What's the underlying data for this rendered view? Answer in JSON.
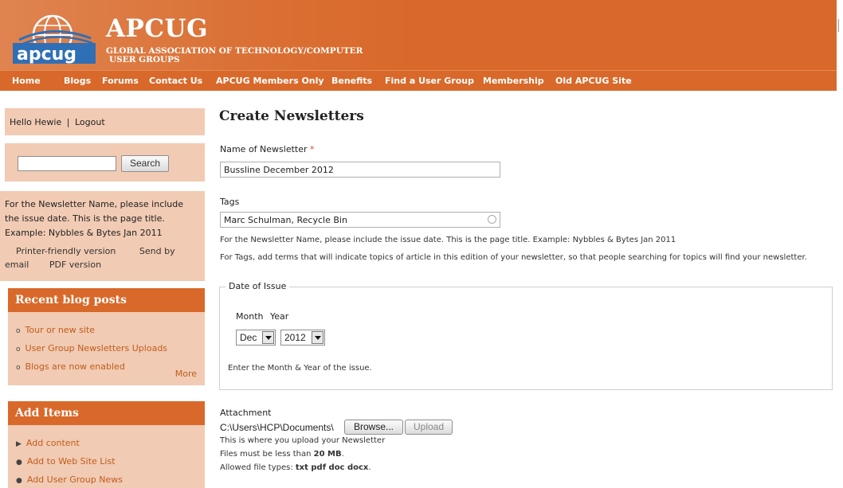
{
  "header": {
    "title": "APCUG",
    "subtitle_line1": "GLOBAL ASSOCIATION OF TECHNOLOGY/COMPUTER",
    "subtitle_line2": "USER GROUPS",
    "logo_text": "apcug"
  },
  "nav": [
    "Home",
    "Blogs",
    "Forums",
    "Contact Us",
    "APCUG Members Only",
    "Benefits",
    "Find a User Group",
    "Membership",
    "Old APCUG Site"
  ],
  "sidebar": {
    "hello": "Hello Hewie",
    "separator": "|",
    "logout": "Logout",
    "search_button": "Search",
    "search_value": "",
    "note_line1": "For the Newsletter Name, please include",
    "note_line2": "the issue date. This is the page title.",
    "note_line3": "Example: Nybbles & Bytes Jan 2011",
    "printer_friendly": "Printer-friendly version",
    "send_by": "Send by",
    "email": "email",
    "pdf_version": "PDF version",
    "recent_title": "Recent blog posts",
    "recent_items": [
      "Tour or new site",
      "User Group Newsletters Uploads",
      "Blogs are now enabled"
    ],
    "more": "More",
    "add_title": "Add Items",
    "add_items": [
      "Add content",
      "Add to Web Site List",
      "Add User Group News"
    ]
  },
  "main": {
    "title": "Create Newsletters",
    "name_label": "Name of Newsletter",
    "required_mark": "*",
    "name_value": "Bussline December 2012",
    "tags_label": "Tags",
    "tags_value": "Marc Schulman, Recycle Bin",
    "help1": "For the Newsletter Name, please include the issue date. This is the page title. Example: Nybbles & Bytes Jan 2011",
    "help2": "For Tags, add terms that will indicate topics of article in this edition of your newsletter, so that people searching for topics will find your newsletter.",
    "date_legend": "Date of Issue",
    "month_label": "Month",
    "year_label": "Year",
    "month_value": "Dec",
    "year_value": "2012",
    "date_help": "Enter the Month & Year of the issue.",
    "attachment_label": "Attachment",
    "file_path": "C:\\Users\\HCP\\Documents\\",
    "browse": "Browse...",
    "upload": "Upload",
    "attach_help1": "This is where you upload your Newsletter",
    "attach_help2a": "Files must be less than ",
    "attach_help2b": "20 MB",
    "attach_help2c": ".",
    "attach_help3a": "Allowed file types: ",
    "attach_help3b": "txt pdf doc docx",
    "attach_help3c": "."
  }
}
